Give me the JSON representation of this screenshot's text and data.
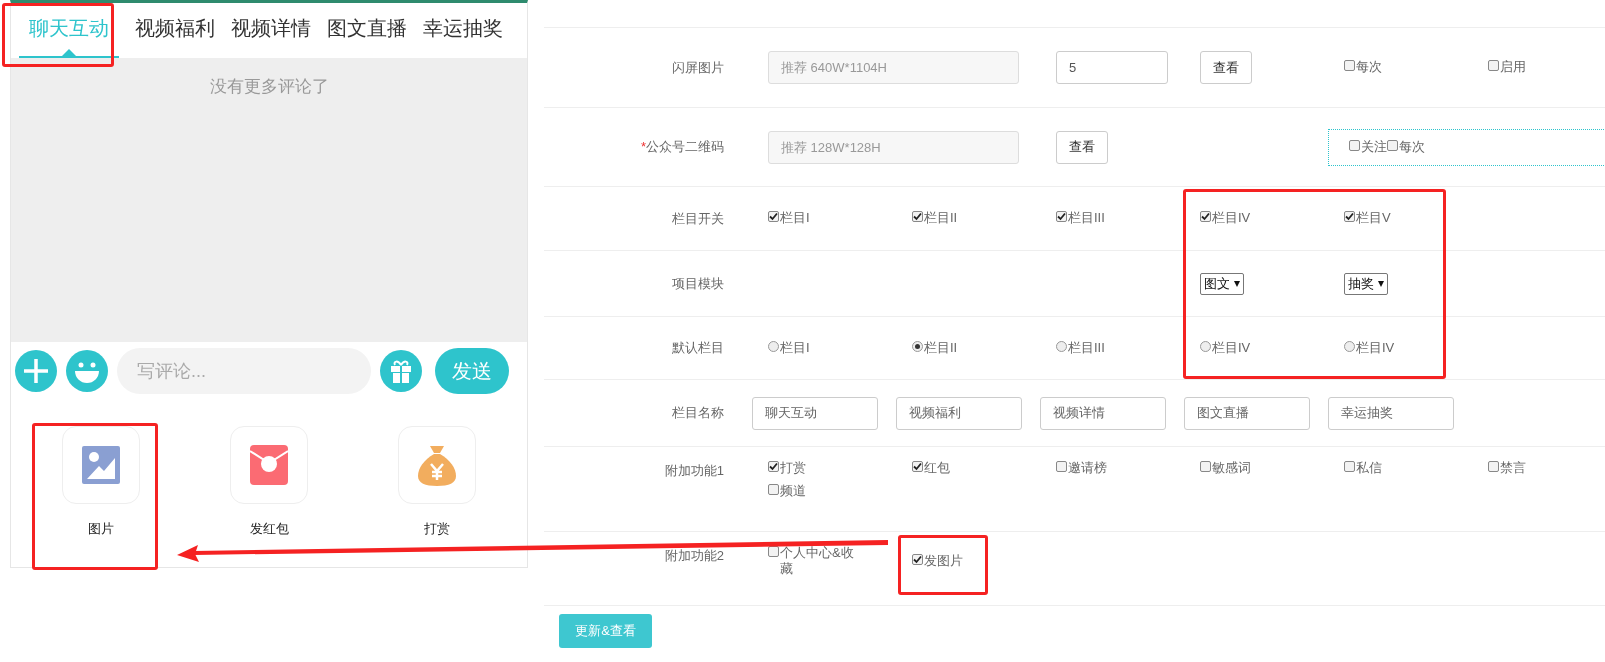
{
  "tabs": [
    {
      "label": "聊天互动",
      "selected": true
    },
    {
      "label": "视频福利",
      "selected": false
    },
    {
      "label": "视频详情",
      "selected": false
    },
    {
      "label": "图文直播",
      "selected": false
    },
    {
      "label": "幸运抽奖",
      "selected": false
    }
  ],
  "empty_message": "没有更多评论了",
  "composer": {
    "placeholder": "写评论...",
    "send": "发送"
  },
  "actions": [
    {
      "label": "图片",
      "kind": "image"
    },
    {
      "label": "发红包",
      "kind": "red-packet"
    },
    {
      "label": "打赏",
      "kind": "reward"
    }
  ],
  "form": {
    "rows": [
      {
        "label": "闪屏图片",
        "items": [
          {
            "kind": "upload",
            "placeholder": "推荐 640W*1104H"
          },
          {
            "kind": "number",
            "value": "5"
          },
          {
            "kind": "button",
            "label": "查看"
          },
          {
            "kind": "checkbox",
            "label": "每次",
            "checked": false
          },
          {
            "kind": "checkbox",
            "label": "启用",
            "checked": false
          }
        ]
      },
      {
        "required_mark": "*",
        "label": "公众号二维码",
        "items": [
          {
            "kind": "upload",
            "placeholder": "推荐 128W*128H"
          },
          {
            "kind": "button",
            "label": "查看"
          },
          {
            "kind": "group",
            "items": [
              {
                "kind": "checkbox",
                "label": "关注",
                "checked": false
              },
              {
                "kind": "checkbox",
                "label": "每次",
                "checked": false
              }
            ]
          }
        ]
      },
      {
        "label": "栏目开关",
        "items": [
          {
            "kind": "checkbox",
            "label": "栏目I",
            "checked": true
          },
          {
            "kind": "checkbox",
            "label": "栏目II",
            "checked": true
          },
          {
            "kind": "checkbox",
            "label": "栏目III",
            "checked": true
          },
          {
            "kind": "checkbox",
            "label": "栏目IV",
            "checked": true
          },
          {
            "kind": "checkbox",
            "label": "栏目V",
            "checked": true
          }
        ]
      },
      {
        "label": "项目模块",
        "items": [
          {
            "kind": "select",
            "value": "图文"
          },
          {
            "kind": "select",
            "value": "抽奖"
          }
        ]
      },
      {
        "label": "默认栏目",
        "items": [
          {
            "kind": "radio",
            "label": "栏目I",
            "selected": false
          },
          {
            "kind": "radio",
            "label": "栏目II",
            "selected": true
          },
          {
            "kind": "radio",
            "label": "栏目III",
            "selected": false
          },
          {
            "kind": "radio",
            "label": "栏目IV",
            "selected": false
          },
          {
            "kind": "radio",
            "label": "栏目IV",
            "selected": false
          }
        ]
      },
      {
        "label": "栏目名称",
        "items": [
          {
            "kind": "text",
            "value": "聊天互动"
          },
          {
            "kind": "text",
            "value": "视频福利"
          },
          {
            "kind": "text",
            "value": "视频详情"
          },
          {
            "kind": "text",
            "value": "图文直播"
          },
          {
            "kind": "text",
            "value": "幸运抽奖"
          }
        ]
      },
      {
        "label": "附加功能1",
        "items": [
          {
            "kind": "checkbox",
            "label": "打赏",
            "checked": true
          },
          {
            "kind": "checkbox",
            "label": "红包",
            "checked": true
          },
          {
            "kind": "checkbox",
            "label": "邀请榜",
            "checked": false
          },
          {
            "kind": "checkbox",
            "label": "敏感词",
            "checked": false
          },
          {
            "kind": "checkbox",
            "label": "私信",
            "checked": false
          },
          {
            "kind": "checkbox",
            "label": "禁言",
            "checked": false
          },
          {
            "kind": "checkbox",
            "label": "频道",
            "checked": false
          }
        ]
      },
      {
        "label": "附加功能2",
        "items": [
          {
            "kind": "checkbox",
            "label": "个人中心&收藏",
            "checked": false
          },
          {
            "kind": "checkbox",
            "label": "发图片",
            "checked": true
          }
        ]
      }
    ],
    "submit": "更新&查看"
  }
}
